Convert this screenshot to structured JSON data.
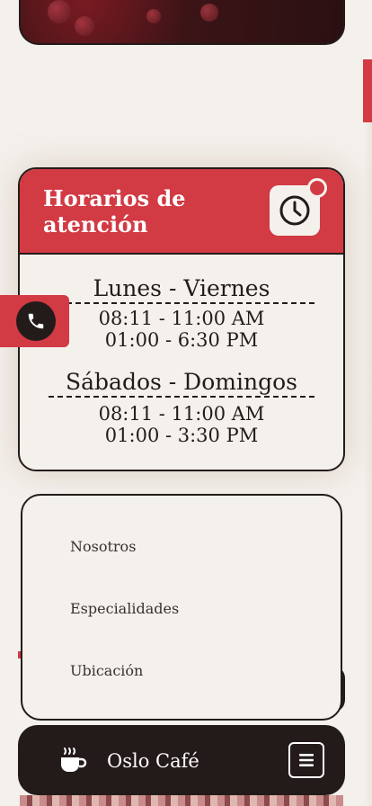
{
  "schedule": {
    "title": "Horarios de atención",
    "weekdays": {
      "title": "Lunes - Viernes",
      "slots": [
        "08:11 - 11:00 AM",
        "01:00 - 6:30 PM"
      ]
    },
    "weekend": {
      "title": "Sábados - Domingos",
      "slots": [
        "08:11 - 11:00 AM",
        "01:00 - 3:30 PM"
      ]
    }
  },
  "menu": {
    "items": [
      "Nosotros",
      "Especialidades",
      "Ubicación"
    ]
  },
  "brand": {
    "name": "Oslo Café"
  },
  "icons": {
    "clock": "clock-icon",
    "phone": "phone-icon",
    "cup": "coffee-cup-icon",
    "menu": "hamburger-menu-icon"
  },
  "colors": {
    "accent": "#d23a44",
    "dark": "#231b1a",
    "background": "#f4f1ed"
  }
}
